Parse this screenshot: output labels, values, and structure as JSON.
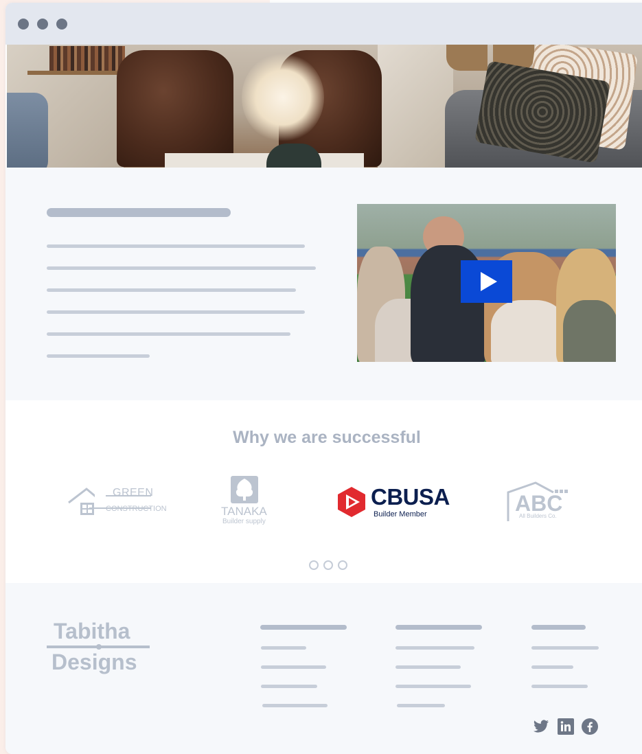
{
  "window": {
    "controls": [
      "close-dot",
      "minimize-dot",
      "maximize-dot"
    ]
  },
  "hero": {
    "image": "living-room-photo"
  },
  "intro": {
    "video": {
      "play_icon": "play-icon"
    }
  },
  "partners": {
    "heading": "Why we are successful",
    "logos": [
      {
        "name": "GREEN",
        "sub": "CONSTRUCTION"
      },
      {
        "name": "TANAKA",
        "sub": "Builder supply"
      },
      {
        "name": "CBUSA",
        "sub": "Builder Member"
      },
      {
        "name": "ABC",
        "sub": "All Builders Co."
      }
    ],
    "carousel_pages": 3
  },
  "footer": {
    "brand_line1": "Tabitha",
    "brand_line2": "Designs",
    "social": [
      "twitter-icon",
      "linkedin-icon",
      "facebook-icon"
    ]
  },
  "colors": {
    "accent": "#0a49d6",
    "cbusa_red": "#e12a2f",
    "cbusa_navy": "#0c1f4f",
    "muted": "#aab3c2"
  }
}
